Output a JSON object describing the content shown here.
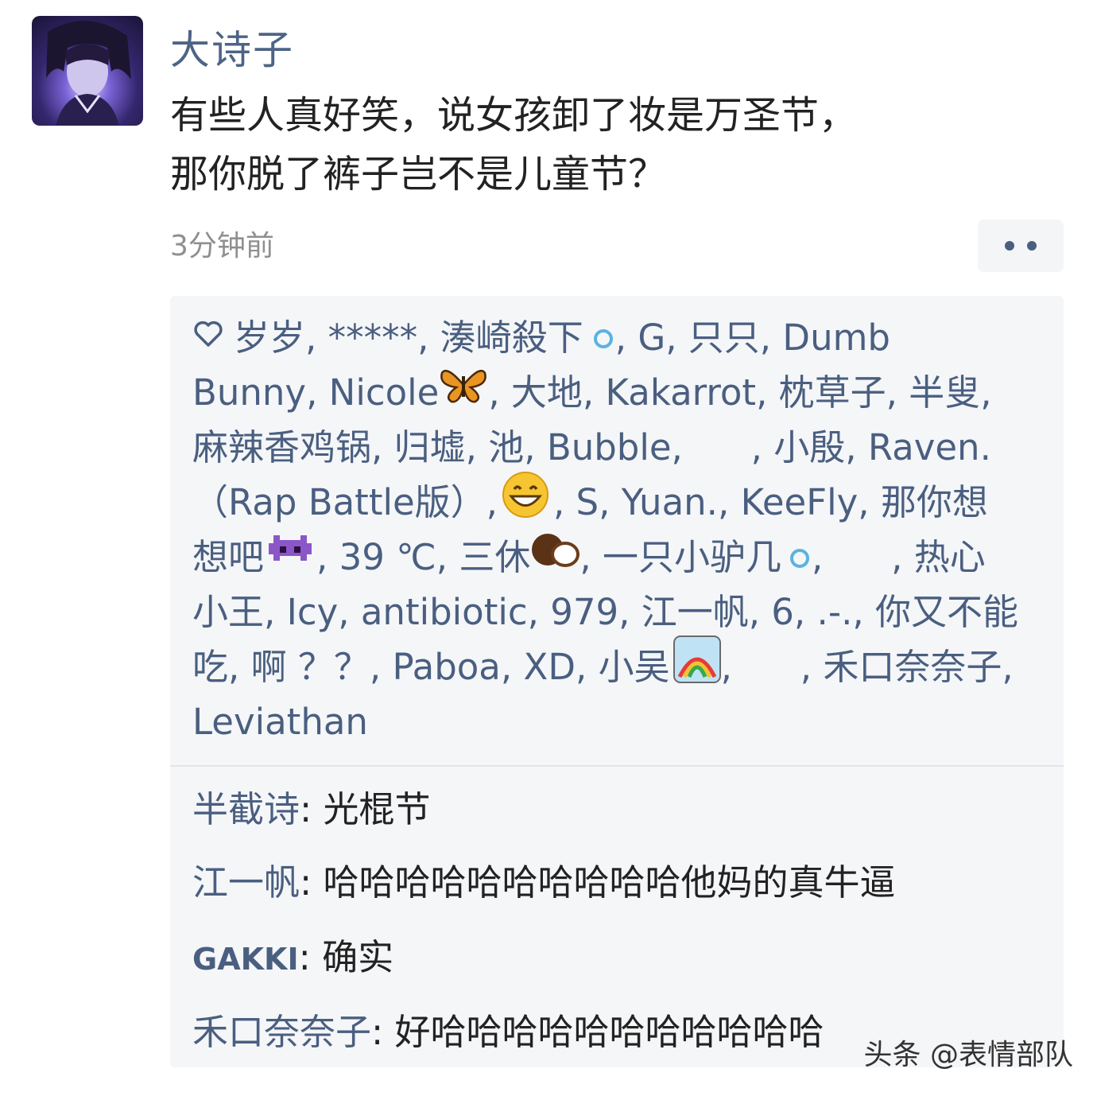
{
  "post": {
    "author": "大诗子",
    "text_line1": "有些人真好笑，说女孩卸了妆是万圣节，",
    "text_line2": "那你脱了裤子岂不是儿童节？",
    "time": "3分钟前"
  },
  "likes": {
    "line1": "岁岁, *****, 湊崎殺下",
    "line1b": ", G, 只只, Dumb",
    "line2a": "Bunny, Nicole",
    "line2b": ", 大地, Kakarrot, 枕草子, 半叟,",
    "line3": "麻辣香鸡锅, 归墟, 池, Bubble,      , 小殷, Raven.",
    "line4a": "（Rap Battle版）,",
    "line4b": ", S, Yuan., KeeFly, 那你想",
    "line5a": "想吧",
    "line5b": ", 39 ℃, 三休",
    "line5c": ", 一只小驴几",
    "line5d": ",      , 热心",
    "line6": "小王, Icy, antibiotic, 979, 江一帆, 6, .-., 你又不能",
    "line7a": "吃, 啊 ？？, Paboa, XD, 小吴",
    "line7b": ",      , 禾口奈奈子,",
    "line8": "Leviathan"
  },
  "comments": [
    {
      "name": "半截诗",
      "sep": ": ",
      "text": "光棍节"
    },
    {
      "name": "江一帆",
      "sep": ": ",
      "text": "哈哈哈哈哈哈哈哈哈哈他妈的真牛逼"
    },
    {
      "name": "GAKKI",
      "sep": ": ",
      "text": "确实"
    },
    {
      "name": "禾口奈奈子",
      "sep": ": ",
      "text": "好哈哈哈哈哈哈哈哈哈哈哈"
    }
  ],
  "watermark": "头条 @表情部队",
  "icons": {
    "heart": "heart-outline-icon",
    "more": "more-dots-icon",
    "butterfly": "butterfly-emoji",
    "grin": "grinning-face-emoji",
    "alien": "alien-monster-emoji",
    "coconut": "coconut-emoji",
    "rainbow": "rainbow-emoji",
    "ring": "ring-emoji"
  },
  "colors": {
    "name_blue": "#4a5f80",
    "panel_bg": "#f5f6f8",
    "time_gray": "#8f8f8f"
  }
}
